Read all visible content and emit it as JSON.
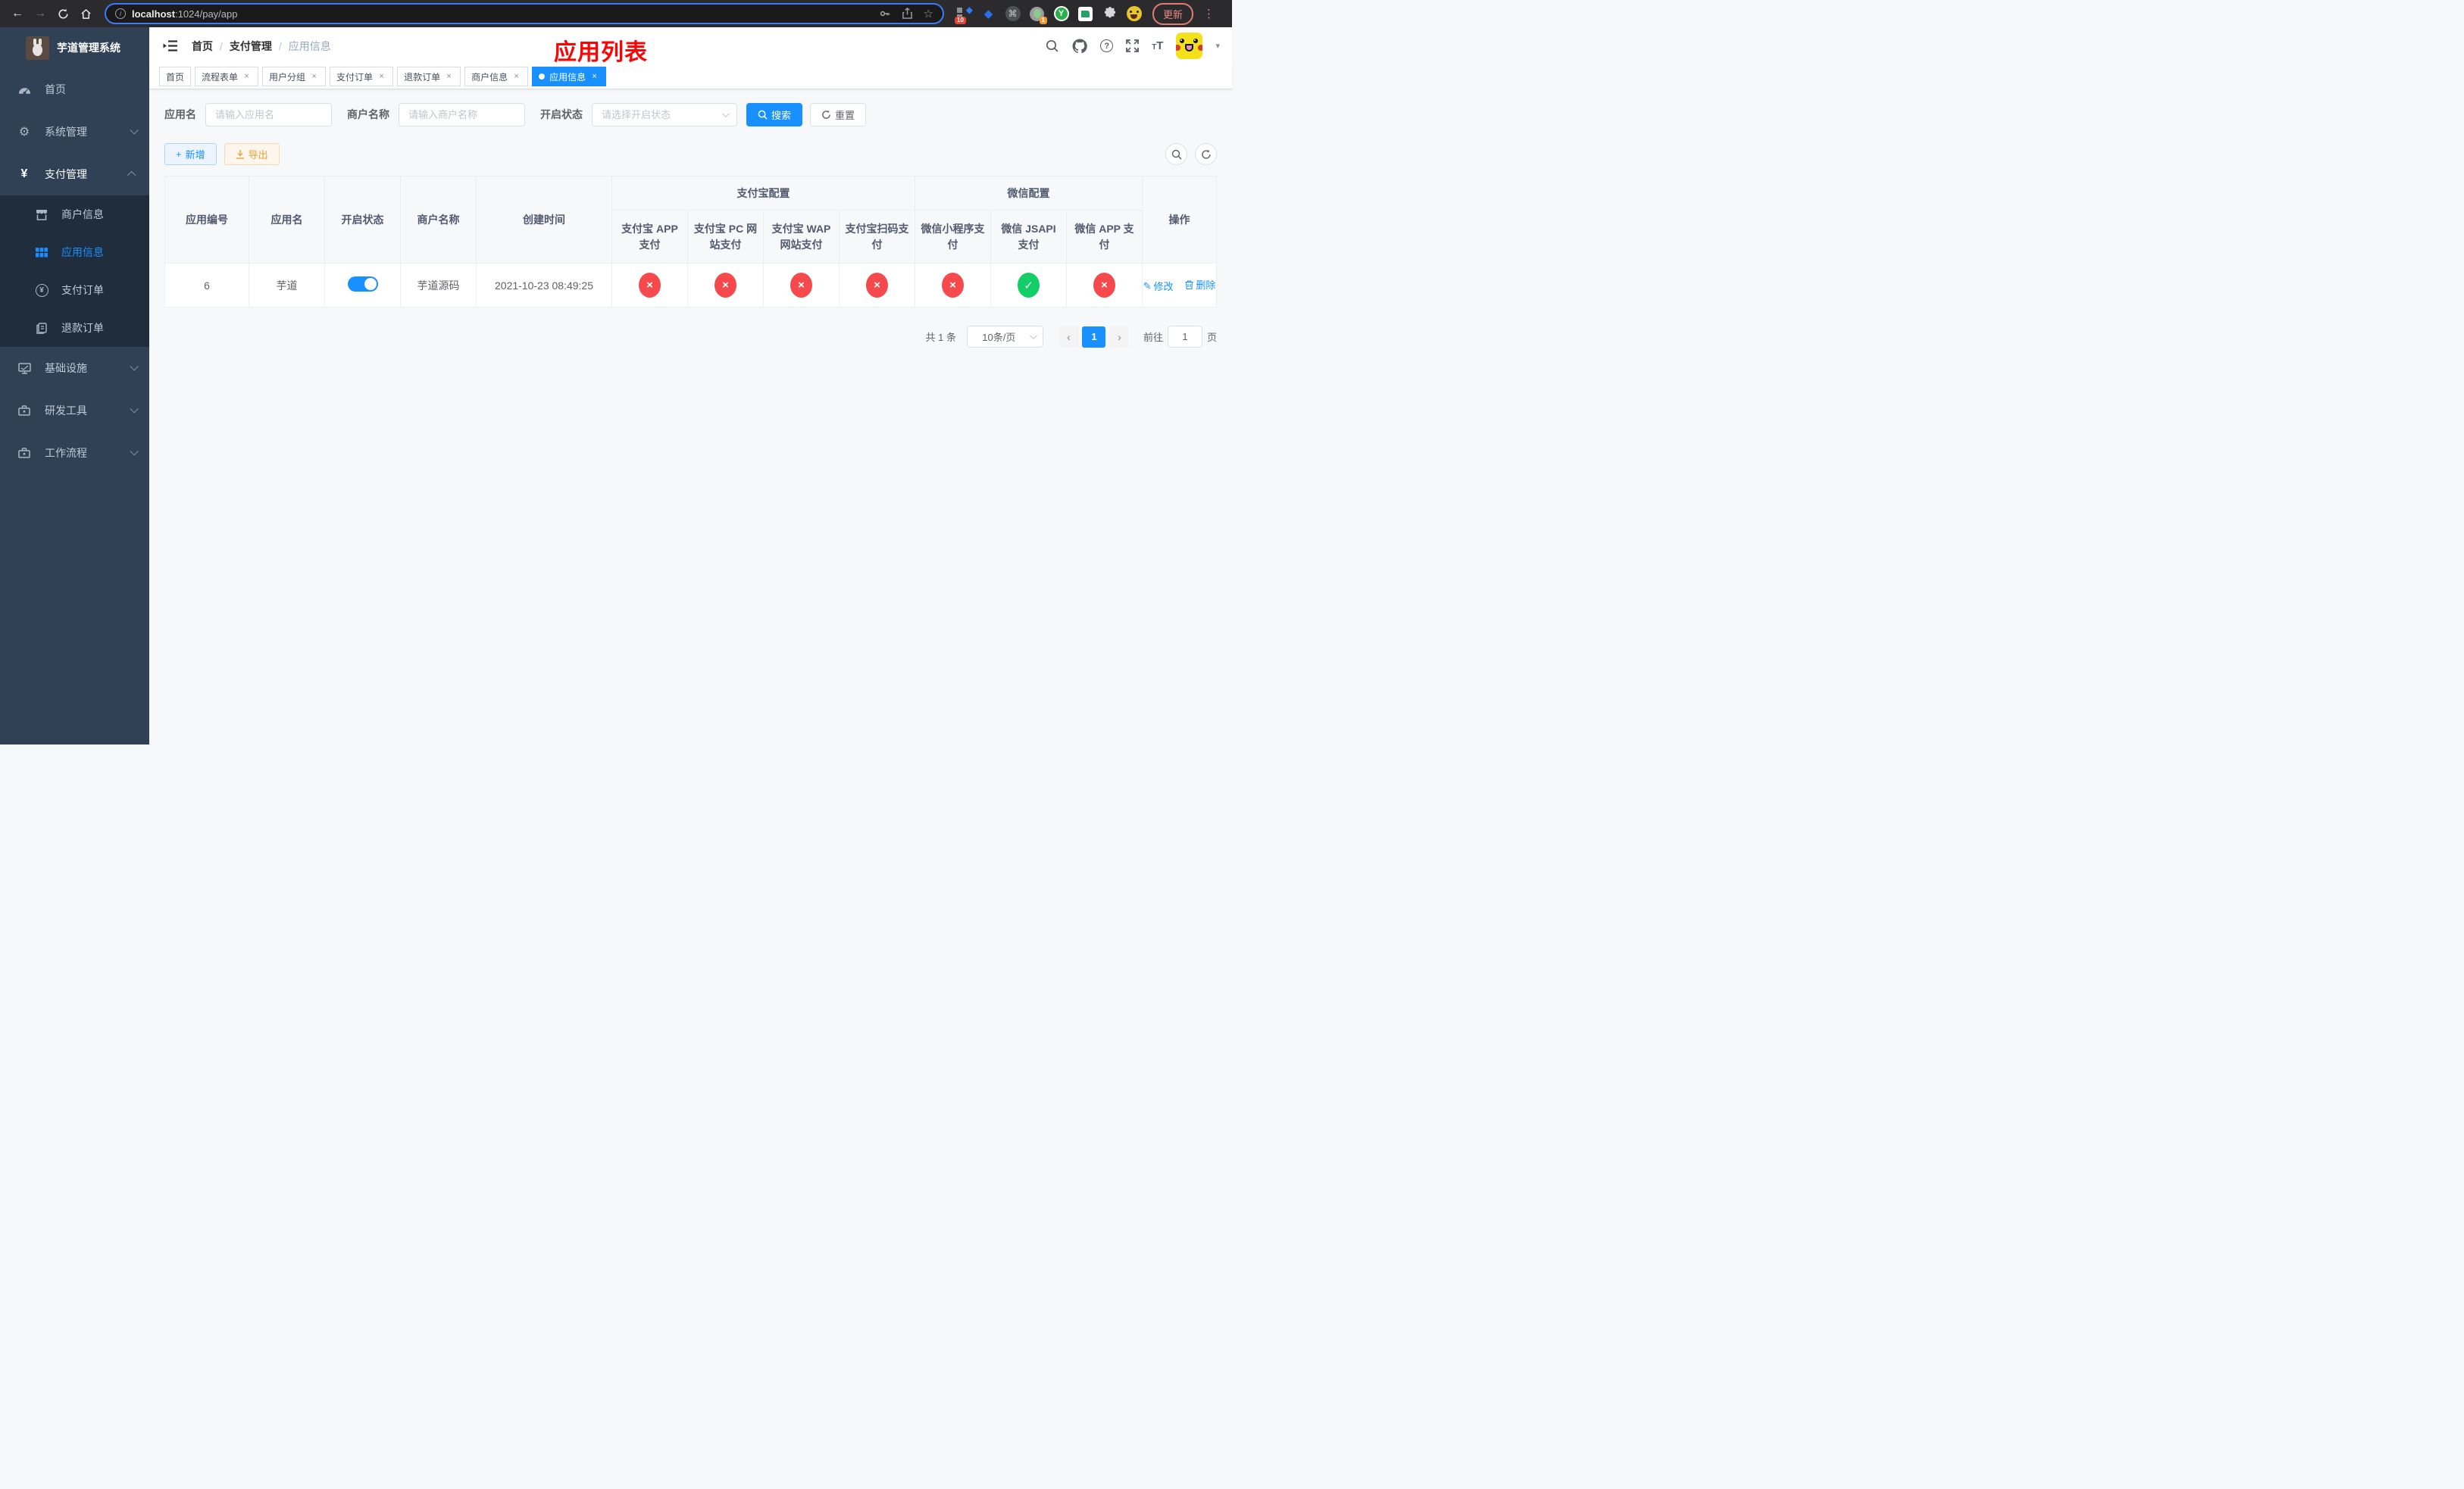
{
  "icons": {
    "back": "←",
    "forward": "→",
    "more": "⋮",
    "star": "☆",
    "cmd": "⌘",
    "diamond": "◆",
    "gear": "⚙",
    "yen": "¥",
    "plus": "+",
    "close": "×",
    "caret": "▾",
    "prev": "‹",
    "next": "›",
    "info": "i",
    "help": "?",
    "y_letter": "Y",
    "font_large": "T",
    "font_small": "T",
    "edit_glyph": "✎"
  },
  "browser": {
    "url_host": "localhost",
    "url_rest": ":1024/pay/app",
    "ext_badge_count": "10",
    "ext_badge_one": "1",
    "update_label": "更新"
  },
  "annotation": {
    "title": "应用列表"
  },
  "sidebar": {
    "logo_title": "芋道管理系统",
    "items": [
      {
        "label": "首页"
      },
      {
        "label": "系统管理"
      },
      {
        "label": "支付管理"
      },
      {
        "label": "商户信息"
      },
      {
        "label": "应用信息"
      },
      {
        "label": "支付订单"
      },
      {
        "label": "退款订单"
      },
      {
        "label": "基础设施"
      },
      {
        "label": "研发工具"
      },
      {
        "label": "工作流程"
      }
    ]
  },
  "breadcrumb": {
    "items": [
      "首页",
      "支付管理",
      "应用信息"
    ]
  },
  "tabs": [
    {
      "label": "首页"
    },
    {
      "label": "流程表单"
    },
    {
      "label": "用户分组"
    },
    {
      "label": "支付订单"
    },
    {
      "label": "退款订单"
    },
    {
      "label": "商户信息"
    },
    {
      "label": "应用信息"
    }
  ],
  "filters": {
    "app_name_label": "应用名",
    "app_name_placeholder": "请输入应用名",
    "merchant_label": "商户名称",
    "merchant_placeholder": "请输入商户名称",
    "status_label": "开启状态",
    "status_placeholder": "请选择开启状态",
    "search_label": "搜索",
    "reset_label": "重置"
  },
  "toolbar": {
    "add_label": "新增",
    "export_label": "导出"
  },
  "table": {
    "columns_left": [
      "应用编号",
      "应用名",
      "开启状态",
      "商户名称",
      "创建时间"
    ],
    "group_alipay": "支付宝配置",
    "group_wechat": "微信配置",
    "sub_columns": [
      "支付宝 APP 支付",
      "支付宝 PC 网站支付",
      "支付宝 WAP 网站支付",
      "支付宝扫码支付",
      "微信小程序支付",
      "微信 JSAPI 支付",
      "微信 APP 支付"
    ],
    "actions_label": "操作",
    "row": {
      "id": "6",
      "name": "芋道",
      "enabled": true,
      "merchant": "芋道源码",
      "created": "2021-10-23 08:49:25",
      "statuses": [
        "x",
        "x",
        "x",
        "x",
        "x",
        "check",
        "x"
      ],
      "edit_label": "修改",
      "delete_label": "删除"
    }
  },
  "pagination": {
    "total_label": "共 1 条",
    "page_size": "10条/页",
    "current_page": "1",
    "goto_label": "前往",
    "goto_value": "1",
    "page_label": "页"
  }
}
